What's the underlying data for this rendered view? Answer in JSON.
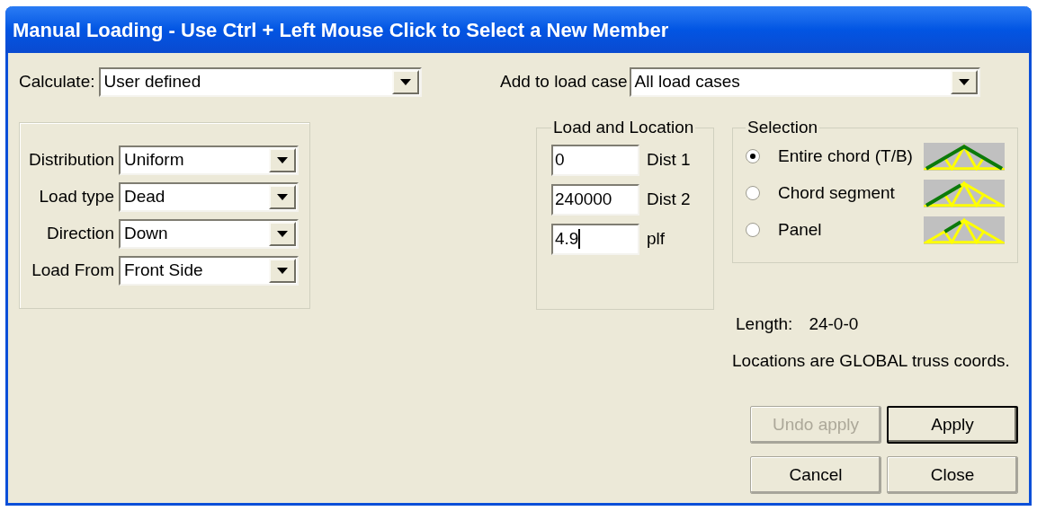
{
  "window": {
    "title": "Manual Loading - Use Ctrl + Left Mouse Click to Select a New Member"
  },
  "calculate": {
    "label": "Calculate:",
    "value": "User defined"
  },
  "add_to_load_case": {
    "label": "Add to load case",
    "value": "All load cases"
  },
  "load_options": [
    {
      "label": "Distribution",
      "value": "Uniform"
    },
    {
      "label": "Load type",
      "value": "Dead"
    },
    {
      "label": "Direction",
      "value": "Down"
    },
    {
      "label": "Load From",
      "value": "Front Side"
    }
  ],
  "load_and_location": {
    "title": "Load and Location",
    "fields": [
      {
        "value": "0",
        "label": "Dist 1",
        "focused": false
      },
      {
        "value": "240000",
        "label": "Dist 2",
        "focused": false
      },
      {
        "value": "4.9",
        "label": "plf",
        "focused": true
      }
    ]
  },
  "selection": {
    "title": "Selection",
    "options": [
      {
        "label": "Entire chord (T/B)",
        "selected": true,
        "kind": "entire"
      },
      {
        "label": "Chord segment",
        "selected": false,
        "kind": "segment"
      },
      {
        "label": "Panel",
        "selected": false,
        "kind": "panel"
      }
    ]
  },
  "length": {
    "label": "Length:",
    "value": "24-0-0"
  },
  "note": "Locations are GLOBAL truss coords.",
  "buttons": [
    {
      "label": "Undo apply",
      "disabled": true,
      "default": false
    },
    {
      "label": "Apply",
      "disabled": false,
      "default": true
    },
    {
      "label": "Cancel",
      "disabled": false,
      "default": false
    },
    {
      "label": "Close",
      "disabled": false,
      "default": false
    }
  ]
}
